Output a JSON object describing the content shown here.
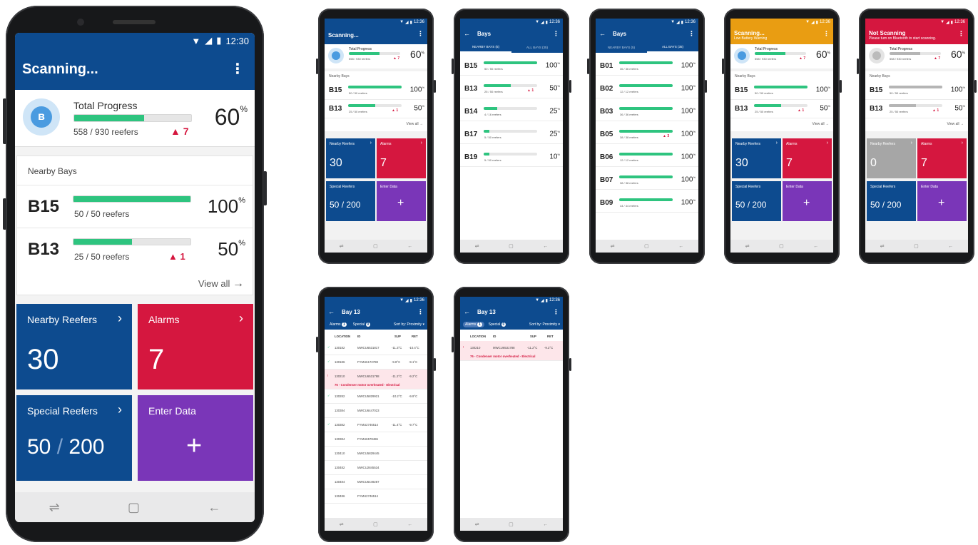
{
  "status_time": "12:30",
  "small_time": "12:36",
  "main": {
    "title": "Scanning...",
    "total_label": "Total Progress",
    "total_count": "558 / 930 reefers",
    "total_pct": "60",
    "total_progress": 0.6,
    "total_alarms": "7",
    "nearby_title": "Nearby Bays",
    "bays": [
      {
        "name": "B15",
        "count": "50 / 50 reefers",
        "pct": "100",
        "progress": 1.0,
        "alarms": ""
      },
      {
        "name": "B13",
        "count": "25 / 50 reefers",
        "pct": "50",
        "progress": 0.5,
        "alarms": "1"
      }
    ],
    "view_all": "View all",
    "tiles": {
      "nearby_label": "Nearby Reefers",
      "nearby_value": "30",
      "alarms_label": "Alarms",
      "alarms_value": "7",
      "special_label": "Special Reefers",
      "special_value": "50",
      "special_sep": "/",
      "special_total": "200",
      "enter_label": "Enter Data",
      "enter_plus": "+"
    },
    "pct_sign": "%",
    "chevron": "›",
    "arrow": "→"
  },
  "bays_screen": {
    "title": "Bays",
    "tab_nearby": "NEARBY BAYS (5)",
    "tab_all": "ALL BAYS (35)",
    "nearby": [
      {
        "name": "B15",
        "count": "50 / 50 reefers",
        "pct": "100",
        "progress": 1.0,
        "alarms": ""
      },
      {
        "name": "B13",
        "count": "25 / 50 reefers",
        "pct": "50",
        "progress": 0.5,
        "alarms": "1"
      },
      {
        "name": "B14",
        "count": "4 / 16 reefers",
        "pct": "25",
        "progress": 0.25,
        "alarms": ""
      },
      {
        "name": "B17",
        "count": "5 / 50 reefers",
        "pct": "25",
        "progress": 0.1,
        "alarms": ""
      },
      {
        "name": "B19",
        "count": "5 / 50 reefers",
        "pct": "10",
        "progress": 0.1,
        "alarms": ""
      }
    ],
    "all": [
      {
        "name": "B01",
        "count": "36 / 36 reefers",
        "pct": "100",
        "progress": 1.0,
        "alarms": ""
      },
      {
        "name": "B02",
        "count": "12 / 12 reefers",
        "pct": "100",
        "progress": 1.0,
        "alarms": ""
      },
      {
        "name": "B03",
        "count": "36 / 36 reefers",
        "pct": "100",
        "progress": 1.0,
        "alarms": ""
      },
      {
        "name": "B05",
        "count": "38 / 38 reefers",
        "pct": "100",
        "progress": 1.0,
        "alarms": "3"
      },
      {
        "name": "B06",
        "count": "12 / 12 reefers",
        "pct": "100",
        "progress": 1.0,
        "alarms": ""
      },
      {
        "name": "B07",
        "count": "38 / 38 reefers",
        "pct": "100",
        "progress": 1.0,
        "alarms": ""
      },
      {
        "name": "B09",
        "count": "44 / 44 reefers",
        "pct": "100",
        "progress": 1.0,
        "alarms": ""
      }
    ]
  },
  "variants": {
    "low_title": "Scanning...",
    "low_subtitle": "Low Battery Warning",
    "off_title": "Not Scanning",
    "off_subtitle": "Please turn on Bluetooth to start scanning.",
    "off_nearby_value": "0"
  },
  "bay_detail": {
    "title": "Bay 13",
    "chip_alarms": "Alarms",
    "chip_alarms_count": "1",
    "chip_special": "Special",
    "chip_special_count": "0",
    "sort": "Sort by: Proximity",
    "headers": [
      "LOCATION",
      "ID",
      "SUP",
      "RET"
    ],
    "rows": [
      {
        "check": "✓",
        "loc": "130182",
        "id": "MWCU6531817",
        "sup": "-11.3°C",
        "ret": "-10.4°C",
        "alarm": ""
      },
      {
        "check": "✓",
        "loc": "130186",
        "id": "FYMU6172788",
        "sup": "-9.8°C",
        "ret": "-9.1°C",
        "alarm": ""
      },
      {
        "check": "!",
        "loc": "130210",
        "id": "MWCU6531788",
        "sup": "-11.2°C",
        "ret": "-9.2°C",
        "alarm": "76 - Condenser motor overheated - Electrical"
      },
      {
        "check": "✓",
        "loc": "130282",
        "id": "MWCU5829921",
        "sup": "-10.2°C",
        "ret": "-9.9°C",
        "alarm": ""
      },
      {
        "check": "",
        "loc": "130384",
        "id": "MWCU6447023",
        "sup": "",
        "ret": "",
        "alarm": ""
      },
      {
        "check": "✓",
        "loc": "130382",
        "id": "FYMU2746514",
        "sup": "-11.4°C",
        "ret": "-9.7°C",
        "alarm": ""
      },
      {
        "check": "",
        "loc": "130384",
        "id": "FYMU6578486",
        "sup": "",
        "ret": "",
        "alarm": ""
      },
      {
        "check": "",
        "loc": "130410",
        "id": "MWCU5829445",
        "sup": "",
        "ret": "",
        "alarm": ""
      },
      {
        "check": "",
        "loc": "130482",
        "id": "MWCU2845534",
        "sup": "",
        "ret": "",
        "alarm": ""
      },
      {
        "check": "",
        "loc": "130484",
        "id": "MWCU6449287",
        "sup": "",
        "ret": "",
        "alarm": ""
      },
      {
        "check": "",
        "loc": "130486",
        "id": "FYMU2746514",
        "sup": "",
        "ret": "",
        "alarm": ""
      }
    ],
    "alarm_rows": [
      {
        "check": "!",
        "loc": "130210",
        "id": "MWCU6531788",
        "sup": "-11.2°C",
        "ret": "-9.2°C",
        "alarm": "76 - Condenser motor overheated - Electrical"
      }
    ]
  },
  "colors": {
    "blue": "#0d4b8f",
    "red": "#d5173f",
    "purple": "#7a36b8",
    "green": "#2ec47f",
    "orange": "#e99d12",
    "gray": "#a6a6a6"
  },
  "icons": [
    "bluetooth-icon",
    "menu-dots-icon",
    "back-arrow-icon",
    "warning-icon",
    "chevron-right-icon",
    "recent-apps-icon",
    "home-icon",
    "back-nav-icon",
    "wifi-icon",
    "signal-icon",
    "battery-icon",
    "check-icon"
  ]
}
